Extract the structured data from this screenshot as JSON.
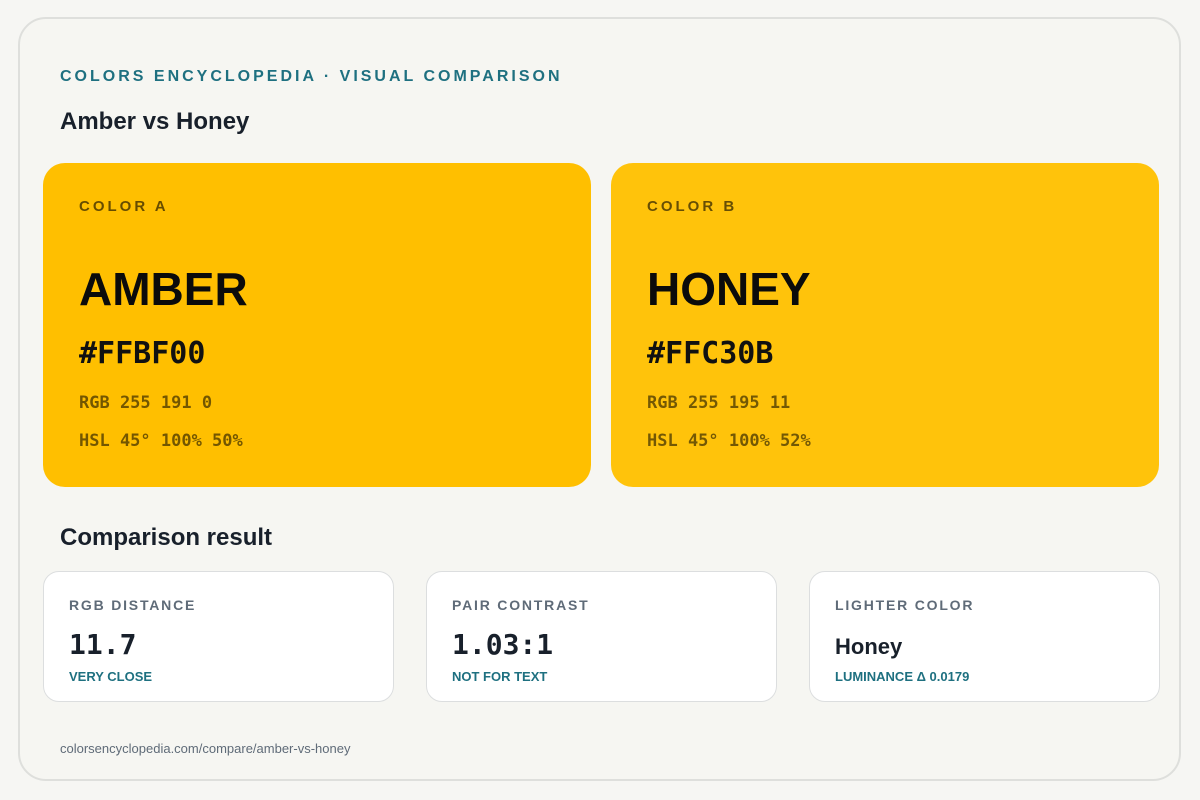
{
  "header": {
    "kicker": "COLORS ENCYCLOPEDIA · VISUAL COMPARISON",
    "title": "Amber vs Honey"
  },
  "colors": [
    {
      "label": "COLOR A",
      "name": "AMBER",
      "hex": "#FFBF00",
      "rgb": "RGB 255 191 0",
      "hsl": "HSL 45° 100% 50%",
      "swatch_color": "#FFBF00"
    },
    {
      "label": "COLOR B",
      "name": "HONEY",
      "hex": "#FFC30B",
      "rgb": "RGB 255 195 11",
      "hsl": "HSL 45° 100% 52%",
      "swatch_color": "#FFC30B"
    }
  ],
  "comparison": {
    "title": "Comparison result",
    "cards": [
      {
        "label": "RGB DISTANCE",
        "value": "11.7",
        "note": "VERY CLOSE"
      },
      {
        "label": "PAIR CONTRAST",
        "value": "1.03:1",
        "note": "NOT FOR TEXT"
      },
      {
        "label": "LIGHTER COLOR",
        "value": "Honey",
        "note": "LUMINANCE Δ 0.0179"
      }
    ]
  },
  "footer": {
    "url": "colorsencyclopedia.com/compare/amber-vs-honey"
  },
  "theme": {
    "accent": "#1E7080",
    "text": "#18202B",
    "muted": "#5F6B78",
    "background": "#F6F6F2"
  }
}
